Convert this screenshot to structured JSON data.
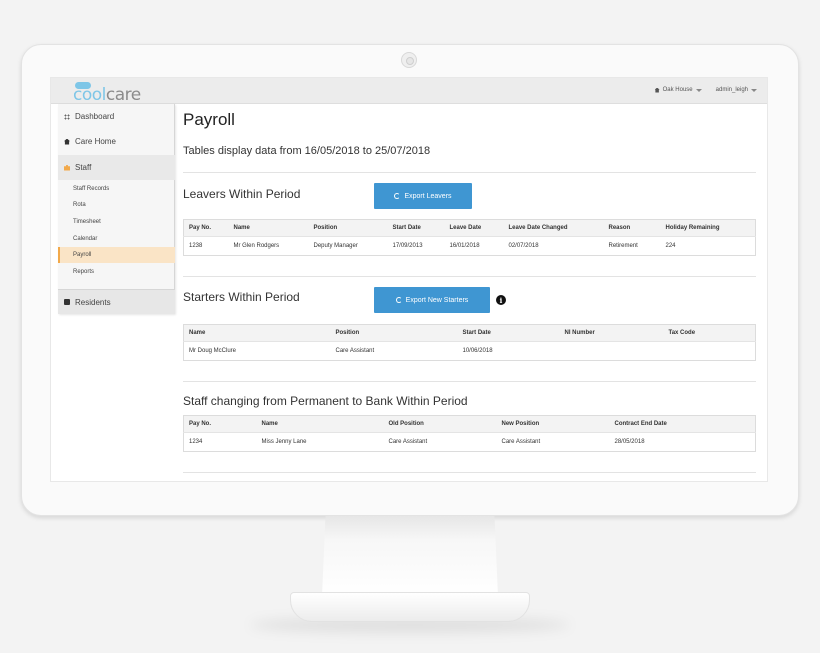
{
  "app": {
    "logo_cool": "cool",
    "logo_care": "care",
    "location": "Oak House",
    "user": "admin_leigh"
  },
  "sidebar": {
    "dashboard": "Dashboard",
    "care_home": "Care Home",
    "staff": "Staff",
    "staff_items": [
      "Staff Records",
      "Rota",
      "Timesheet",
      "Calendar",
      "Payroll",
      "Reports"
    ],
    "residents": "Residents"
  },
  "page": {
    "title": "Payroll",
    "period": "Tables display data from 16/05/2018 to 25/07/2018"
  },
  "leavers": {
    "heading": "Leavers Within Period",
    "export_label": "Export Leavers",
    "columns": [
      "Pay No.",
      "Name",
      "Position",
      "Start Date",
      "Leave Date",
      "Leave Date Changed",
      "Reason",
      "Holiday Remaining"
    ],
    "rows": [
      [
        "1238",
        "Mr Glen Rodgers",
        "Deputy Manager",
        "17/09/2013",
        "16/01/2018",
        "02/07/2018",
        "Retirement",
        "224"
      ]
    ]
  },
  "starters": {
    "heading": "Starters Within Period",
    "export_label": "Export New Starters",
    "columns": [
      "Name",
      "Position",
      "Start Date",
      "NI Number",
      "Tax Code"
    ],
    "rows": [
      [
        "Mr Doug McClure",
        "Care Assistant",
        "10/06/2018",
        "",
        ""
      ]
    ]
  },
  "bank": {
    "heading": "Staff changing from Permanent to Bank Within Period",
    "columns": [
      "Pay No.",
      "Name",
      "Old Position",
      "New Position",
      "Contract End Date"
    ],
    "rows": [
      [
        "1234",
        "Miss Jenny Lane",
        "Care Assistant",
        "Care Assistant",
        "28/05/2018"
      ]
    ]
  }
}
